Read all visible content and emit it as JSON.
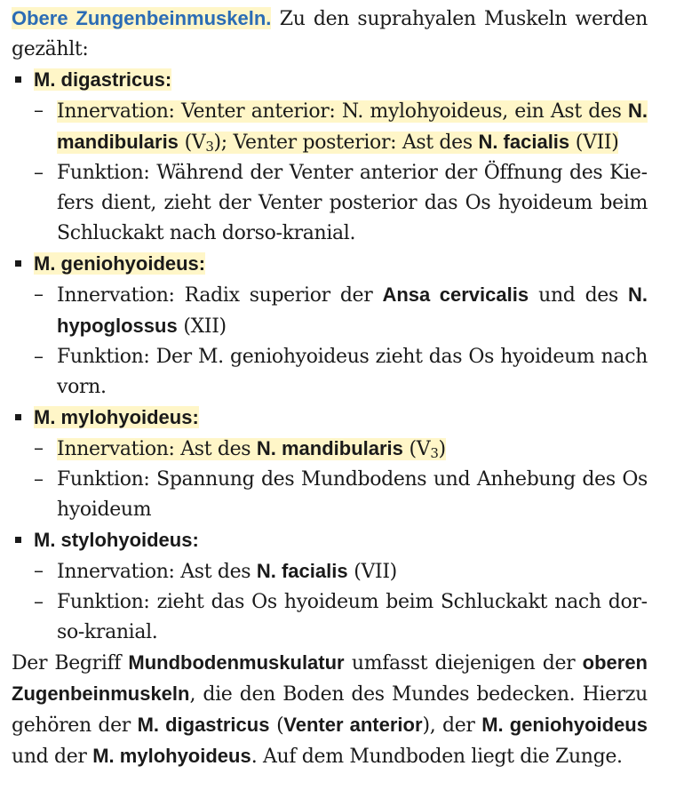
{
  "intro": {
    "heading": "Obere Zungenbeinmuskeln.",
    "text": " Zu den suprahyalen Muskeln wer­den gezählt:"
  },
  "dash": "–",
  "muscles": [
    {
      "title": " M. digastricus:",
      "innervation": {
        "a": "Innervation: Venter anterior: N. mylohyoideus, ein Ast des ",
        "b": "N. mandibularis",
        "c": " (V",
        "sub": "3",
        "d": "); ",
        "e": "Venter posterior: Ast des ",
        "f": "N. facialis",
        "g": " (VII)"
      },
      "funktion": "Funktion: Während der Venter anterior der Öffnung des Kie­fers dient, zieht der Venter posterior das Os hyoideum beim Schluckakt nach dorso-kranial."
    },
    {
      "title": "M. geniohyoideus:",
      "innervation": {
        "a": "Innervation: Radix superior der ",
        "b": "Ansa cervicalis",
        "c": " und des ",
        "d": "N. hypoglossus",
        "e": " (XII)"
      },
      "funktion": "Funktion: Der M. geniohyoideus zieht das Os hyoideum nach vorn."
    },
    {
      "title": "M. mylohyoideus:",
      "innervation": {
        "a": "Innervation: Ast des ",
        "b": "N. mandibularis",
        "c": " (V",
        "sub": "3",
        "d": ")"
      },
      "funktion": "Funktion: Spannung des Mundbodens und Anhebung des Os hyoideum"
    },
    {
      "title": "M. stylohyoideus:",
      "innervation": {
        "a": "Innervation: Ast des ",
        "b": "N. facialis",
        "c": " (VII)"
      },
      "funktion": "Funktion: zieht das Os hyoideum beim Schluckakt nach dor­so-kranial."
    }
  ],
  "outro": {
    "t1": "Der Begriff ",
    "b1": "Mundbodenmuskulatur",
    "t2": " umfasst diejenigen der ",
    "b2": "obe­ren Zugenbeinmuskeln",
    "t3": ", die den Boden des Mundes bedecken. Hierzu gehören der ",
    "b3": "M. digastricus",
    "t4": " (",
    "b4": "Venter anterior",
    "t5": "), der ",
    "b5": "M. ge­niohyoideus",
    "t6": " und der ",
    "b6": "M. mylohyoideus",
    "t7": ". Auf dem Mundboden liegt die Zunge."
  },
  "colors": {
    "heading": "#2b6cb5",
    "highlight": "#fff6c8",
    "text": "#1a1a1a"
  }
}
